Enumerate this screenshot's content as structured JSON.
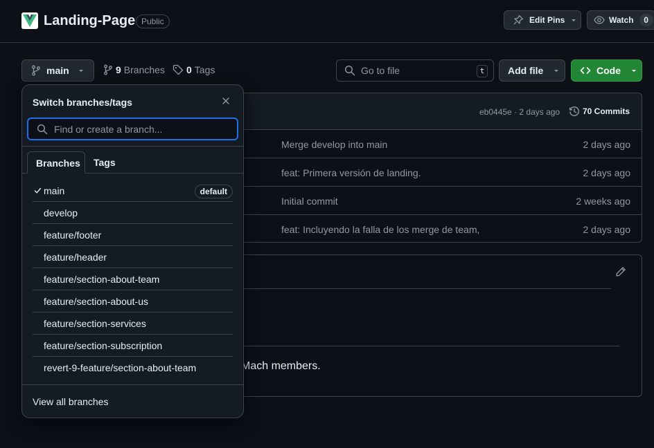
{
  "repo": {
    "name": "Landing-Page",
    "visibility": "Public",
    "edit_pins_label": "Edit Pins",
    "watch_label": "Watch",
    "watch_count": "0"
  },
  "toolbar": {
    "branch": "main",
    "branches_count": "9",
    "branches_label": "Branches",
    "tags_count": "0",
    "tags_label": "Tags",
    "goto_placeholder": "Go to file",
    "goto_shortcut": "t",
    "add_file_label": "Add file",
    "code_label": "Code"
  },
  "commit_bar": {
    "sha_time": "eb0445e · 2 days ago",
    "commits_label": "70 Commits"
  },
  "file_rows": [
    {
      "message": "Merge develop into main",
      "age": "2 days ago"
    },
    {
      "message": "feat: Primera versión de landing.",
      "age": "2 days ago"
    },
    {
      "message": "Initial commit",
      "age": "2 weeks ago"
    },
    {
      "message": "feat: Incluyendo la falla de los merge de team,",
      "age": "2 days ago"
    }
  ],
  "readme": {
    "text_fragment": "Mach members."
  },
  "branch_menu": {
    "title": "Switch branches/tags",
    "search_placeholder": "Find or create a branch...",
    "tab_branches": "Branches",
    "tab_tags": "Tags",
    "default_badge": "default",
    "branches": [
      "main",
      "develop",
      "feature/footer",
      "feature/header",
      "feature/section-about-team",
      "feature/section-about-us",
      "feature/section-services",
      "feature/section-subscription",
      "revert-9-feature/section-about-team"
    ],
    "view_all_label": "View all branches"
  },
  "colors": {
    "background": "#0d1117",
    "border": "#3d444d",
    "code_button": "#238636",
    "focus_ring": "#1f6feb",
    "muted_text": "#9198a1"
  }
}
